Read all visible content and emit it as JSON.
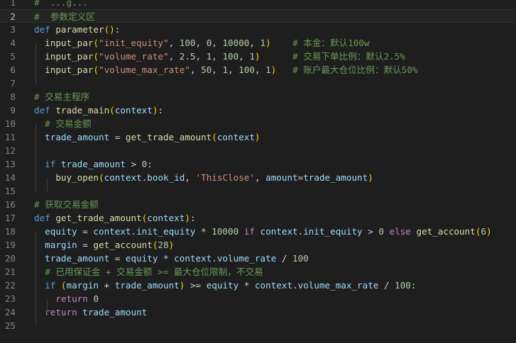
{
  "editor": {
    "lines": [
      {
        "no": "1",
        "tokens": [
          {
            "t": "cmt",
            "v": "#  ...g..."
          }
        ]
      },
      {
        "no": "2",
        "active": true,
        "tokens": [
          {
            "t": "cmt",
            "v": "#  参数定义区"
          }
        ]
      },
      {
        "no": "3",
        "tokens": [
          {
            "t": "kw",
            "v": "def "
          },
          {
            "t": "fn",
            "v": "parameter"
          },
          {
            "t": "pn1",
            "v": "()"
          },
          {
            "t": "op",
            "v": ":"
          }
        ]
      },
      {
        "no": "4",
        "tokens": [
          {
            "t": "op",
            "v": "  "
          },
          {
            "t": "fn",
            "v": "input_par"
          },
          {
            "t": "pn1",
            "v": "("
          },
          {
            "t": "str",
            "v": "\"init_equity\""
          },
          {
            "t": "op",
            "v": ", "
          },
          {
            "t": "num",
            "v": "100"
          },
          {
            "t": "op",
            "v": ", "
          },
          {
            "t": "num",
            "v": "0"
          },
          {
            "t": "op",
            "v": ", "
          },
          {
            "t": "num",
            "v": "10000"
          },
          {
            "t": "op",
            "v": ", "
          },
          {
            "t": "num",
            "v": "1"
          },
          {
            "t": "pn1",
            "v": ")"
          },
          {
            "t": "op",
            "v": "    "
          },
          {
            "t": "cmt",
            "v": "# 本金：默认100w"
          }
        ]
      },
      {
        "no": "5",
        "tokens": [
          {
            "t": "op",
            "v": "  "
          },
          {
            "t": "fn",
            "v": "input_par"
          },
          {
            "t": "pn1",
            "v": "("
          },
          {
            "t": "str",
            "v": "\"volume_rate\""
          },
          {
            "t": "op",
            "v": ", "
          },
          {
            "t": "num",
            "v": "2.5"
          },
          {
            "t": "op",
            "v": ", "
          },
          {
            "t": "num",
            "v": "1"
          },
          {
            "t": "op",
            "v": ", "
          },
          {
            "t": "num",
            "v": "100"
          },
          {
            "t": "op",
            "v": ", "
          },
          {
            "t": "num",
            "v": "1"
          },
          {
            "t": "pn1",
            "v": ")"
          },
          {
            "t": "op",
            "v": "      "
          },
          {
            "t": "cmt",
            "v": "# 交易下单比例：默认2.5%"
          }
        ]
      },
      {
        "no": "6",
        "tokens": [
          {
            "t": "op",
            "v": "  "
          },
          {
            "t": "fn",
            "v": "input_par"
          },
          {
            "t": "pn1",
            "v": "("
          },
          {
            "t": "str",
            "v": "\"volume_max_rate\""
          },
          {
            "t": "op",
            "v": ", "
          },
          {
            "t": "num",
            "v": "50"
          },
          {
            "t": "op",
            "v": ", "
          },
          {
            "t": "num",
            "v": "1"
          },
          {
            "t": "op",
            "v": ", "
          },
          {
            "t": "num",
            "v": "100"
          },
          {
            "t": "op",
            "v": ", "
          },
          {
            "t": "num",
            "v": "1"
          },
          {
            "t": "pn1",
            "v": ")"
          },
          {
            "t": "op",
            "v": "   "
          },
          {
            "t": "cmt",
            "v": "# 账户最大仓位比例：默认50%"
          }
        ]
      },
      {
        "no": "7",
        "tokens": []
      },
      {
        "no": "8",
        "tokens": [
          {
            "t": "cmt",
            "v": "# 交易主程序"
          }
        ]
      },
      {
        "no": "9",
        "tokens": [
          {
            "t": "kw",
            "v": "def "
          },
          {
            "t": "fn",
            "v": "trade_main"
          },
          {
            "t": "pn1",
            "v": "("
          },
          {
            "t": "var",
            "v": "context"
          },
          {
            "t": "pn1",
            "v": ")"
          },
          {
            "t": "op",
            "v": ":"
          }
        ]
      },
      {
        "no": "10",
        "tokens": [
          {
            "t": "op",
            "v": "  "
          },
          {
            "t": "cmt",
            "v": "# 交易金额"
          }
        ]
      },
      {
        "no": "11",
        "tokens": [
          {
            "t": "op",
            "v": "  "
          },
          {
            "t": "var",
            "v": "trade_amount"
          },
          {
            "t": "op",
            "v": " = "
          },
          {
            "t": "fn",
            "v": "get_trade_amount"
          },
          {
            "t": "pn1",
            "v": "("
          },
          {
            "t": "var",
            "v": "context"
          },
          {
            "t": "pn1",
            "v": ")"
          }
        ]
      },
      {
        "no": "12",
        "tokens": []
      },
      {
        "no": "13",
        "tokens": [
          {
            "t": "op",
            "v": "  "
          },
          {
            "t": "kw",
            "v": "if "
          },
          {
            "t": "var",
            "v": "trade_amount"
          },
          {
            "t": "op",
            "v": " > "
          },
          {
            "t": "num",
            "v": "0"
          },
          {
            "t": "op",
            "v": ":"
          }
        ]
      },
      {
        "no": "14",
        "tokens": [
          {
            "t": "op",
            "v": "    "
          },
          {
            "t": "fn",
            "v": "buy_open"
          },
          {
            "t": "pn1",
            "v": "("
          },
          {
            "t": "var",
            "v": "context"
          },
          {
            "t": "op",
            "v": "."
          },
          {
            "t": "var",
            "v": "book_id"
          },
          {
            "t": "op",
            "v": ", "
          },
          {
            "t": "str",
            "v": "'ThisClose'"
          },
          {
            "t": "op",
            "v": ", "
          },
          {
            "t": "var",
            "v": "amount"
          },
          {
            "t": "op",
            "v": "="
          },
          {
            "t": "var",
            "v": "trade_amount"
          },
          {
            "t": "pn1",
            "v": ")"
          }
        ]
      },
      {
        "no": "15",
        "tokens": []
      },
      {
        "no": "16",
        "tokens": [
          {
            "t": "cmt",
            "v": "# 获取交易金额"
          }
        ]
      },
      {
        "no": "17",
        "tokens": [
          {
            "t": "kw",
            "v": "def "
          },
          {
            "t": "fn",
            "v": "get_trade_amount"
          },
          {
            "t": "pn1",
            "v": "("
          },
          {
            "t": "var",
            "v": "context"
          },
          {
            "t": "pn1",
            "v": ")"
          },
          {
            "t": "op",
            "v": ":"
          }
        ]
      },
      {
        "no": "18",
        "tokens": [
          {
            "t": "op",
            "v": "  "
          },
          {
            "t": "var",
            "v": "equity"
          },
          {
            "t": "op",
            "v": " = "
          },
          {
            "t": "var",
            "v": "context"
          },
          {
            "t": "op",
            "v": "."
          },
          {
            "t": "var",
            "v": "init_equity"
          },
          {
            "t": "op",
            "v": " * "
          },
          {
            "t": "num",
            "v": "10000"
          },
          {
            "t": "op",
            "v": " "
          },
          {
            "t": "ctl",
            "v": "if"
          },
          {
            "t": "op",
            "v": " "
          },
          {
            "t": "var",
            "v": "context"
          },
          {
            "t": "op",
            "v": "."
          },
          {
            "t": "var",
            "v": "init_equity"
          },
          {
            "t": "op",
            "v": " > "
          },
          {
            "t": "num",
            "v": "0"
          },
          {
            "t": "op",
            "v": " "
          },
          {
            "t": "ctl",
            "v": "else"
          },
          {
            "t": "op",
            "v": " "
          },
          {
            "t": "fn",
            "v": "get_account"
          },
          {
            "t": "pn1",
            "v": "("
          },
          {
            "t": "num",
            "v": "6"
          },
          {
            "t": "pn1",
            "v": ")"
          }
        ]
      },
      {
        "no": "19",
        "tokens": [
          {
            "t": "op",
            "v": "  "
          },
          {
            "t": "var",
            "v": "margin"
          },
          {
            "t": "op",
            "v": " = "
          },
          {
            "t": "fn",
            "v": "get_account"
          },
          {
            "t": "pn1",
            "v": "("
          },
          {
            "t": "num",
            "v": "28"
          },
          {
            "t": "pn1",
            "v": ")"
          }
        ]
      },
      {
        "no": "20",
        "tokens": [
          {
            "t": "op",
            "v": "  "
          },
          {
            "t": "var",
            "v": "trade_amount"
          },
          {
            "t": "op",
            "v": " = "
          },
          {
            "t": "var",
            "v": "equity"
          },
          {
            "t": "op",
            "v": " * "
          },
          {
            "t": "var",
            "v": "context"
          },
          {
            "t": "op",
            "v": "."
          },
          {
            "t": "var",
            "v": "volume_rate"
          },
          {
            "t": "op",
            "v": " / "
          },
          {
            "t": "num",
            "v": "100"
          }
        ]
      },
      {
        "no": "21",
        "tokens": [
          {
            "t": "op",
            "v": "  "
          },
          {
            "t": "cmt",
            "v": "# 已用保证金 + 交易金额 >= 最大仓位限制，不交易"
          }
        ]
      },
      {
        "no": "22",
        "tokens": [
          {
            "t": "op",
            "v": "  "
          },
          {
            "t": "kw",
            "v": "if "
          },
          {
            "t": "pn1",
            "v": "("
          },
          {
            "t": "var",
            "v": "margin"
          },
          {
            "t": "op",
            "v": " + "
          },
          {
            "t": "var",
            "v": "trade_amount"
          },
          {
            "t": "pn1",
            "v": ")"
          },
          {
            "t": "op",
            "v": " >= "
          },
          {
            "t": "var",
            "v": "equity"
          },
          {
            "t": "op",
            "v": " * "
          },
          {
            "t": "var",
            "v": "context"
          },
          {
            "t": "op",
            "v": "."
          },
          {
            "t": "var",
            "v": "volume_max_rate"
          },
          {
            "t": "op",
            "v": " / "
          },
          {
            "t": "num",
            "v": "100"
          },
          {
            "t": "op",
            "v": ":"
          }
        ]
      },
      {
        "no": "23",
        "tokens": [
          {
            "t": "op",
            "v": "    "
          },
          {
            "t": "ctl",
            "v": "return"
          },
          {
            "t": "op",
            "v": " "
          },
          {
            "t": "num",
            "v": "0"
          }
        ]
      },
      {
        "no": "24",
        "tokens": [
          {
            "t": "op",
            "v": "  "
          },
          {
            "t": "ctl",
            "v": "return"
          },
          {
            "t": "op",
            "v": " "
          },
          {
            "t": "var",
            "v": "trade_amount"
          }
        ]
      },
      {
        "no": "25",
        "tokens": []
      }
    ]
  }
}
